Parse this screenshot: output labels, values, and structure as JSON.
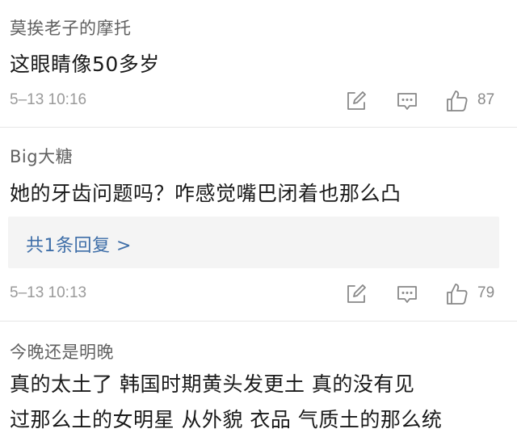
{
  "comments": [
    {
      "username": "莫挨老子的摩托",
      "content": "这眼睛像50多岁",
      "timestamp": "5–13 10:16",
      "likes": "87"
    },
    {
      "username": "Big大糖",
      "content": "她的牙齿问题吗？咋感觉嘴巴闭着也那么凸",
      "reply_summary": "共1条回复 >",
      "timestamp": "5–13 10:13",
      "likes": "79"
    },
    {
      "username": "今晚还是明晚",
      "content_line1": "真的太土了   韩国时期黄头发更土    真的没有见",
      "content_line2": "过那么土的女明星   从外貌 衣品  气质土的那么统"
    }
  ],
  "icons": {
    "edit": "edit-icon",
    "comment": "comment-icon",
    "like": "thumbs-up-icon"
  },
  "colors": {
    "username": "#606060",
    "content": "#1a1a1a",
    "meta": "#9a9a9a",
    "icon": "#888888",
    "reply_link": "#3e6ea8",
    "reply_bg": "#f4f4f4"
  }
}
